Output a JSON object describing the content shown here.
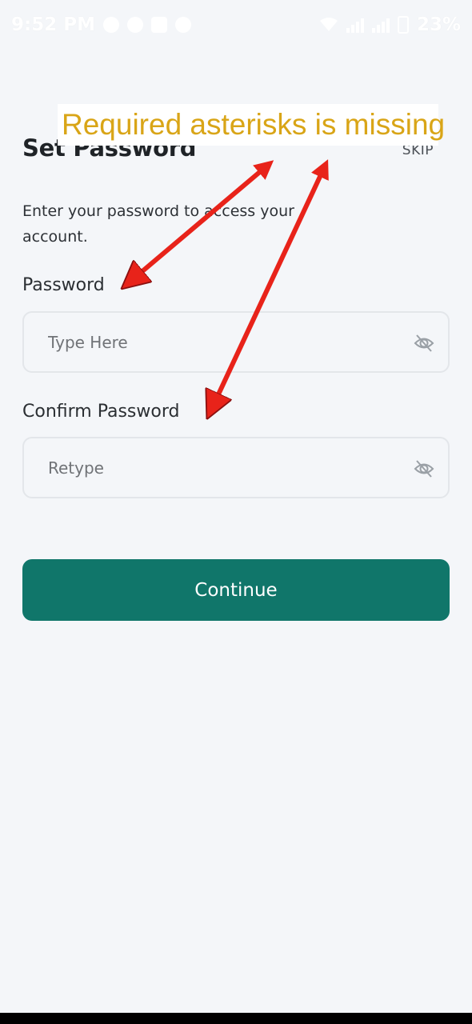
{
  "status_bar": {
    "time": "9:52 PM",
    "battery": "23%"
  },
  "screen": {
    "title": "Set Password",
    "skip_label": "SKIP",
    "subtitle": "Enter your password to access your account."
  },
  "form": {
    "password": {
      "label": "Password",
      "placeholder": "Type Here"
    },
    "confirm_password": {
      "label": "Confirm Password",
      "placeholder": "Retype"
    },
    "continue_label": "Continue"
  },
  "annotation": {
    "text": "Required asterisks is missing"
  },
  "colors": {
    "primary": "#10766a",
    "background": "#f4f6f9",
    "annotation_text": "#d9a517",
    "arrow": "#e8231a"
  },
  "icons": [
    "messenger-icon",
    "chat-icon",
    "instagram-icon",
    "game-icon",
    "wifi-icon",
    "signal-icon",
    "battery-icon",
    "eye-off-icon"
  ]
}
